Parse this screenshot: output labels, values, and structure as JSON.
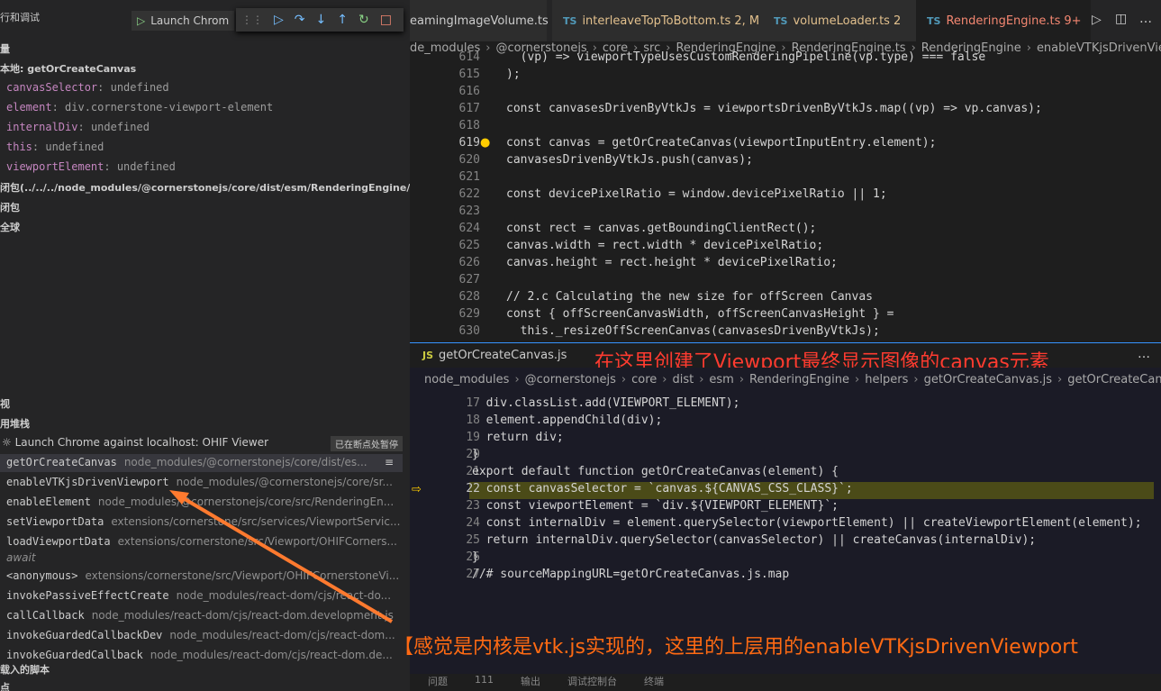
{
  "sidebar": {
    "header": "行和调试",
    "launch_label": "Launch Chrom",
    "variables_section": "量",
    "local_scope": "本地: getOrCreateCanvas",
    "variables": [
      {
        "name": "canvasSelector",
        "value": "undefined"
      },
      {
        "name": "element",
        "value": "div.cornerstone-viewport-element"
      },
      {
        "name": "internalDiv",
        "value": "undefined"
      },
      {
        "name": "this",
        "value": "undefined"
      },
      {
        "name": "viewportElement",
        "value": "undefined"
      }
    ],
    "closure_scope": "闭包(../../../node_modules/@cornerstonejs/core/dist/esm/RenderingEngine/helpers/getO",
    "closure2": "闭包",
    "global": "全球",
    "watch_section": "视",
    "callstack_section": "用堆栈",
    "session": "Launch Chrome against localhost: OHIF Viewer",
    "paused_badge": "已在断点处暂停",
    "frames": [
      {
        "fn": "getOrCreateCanvas",
        "src": "node_modules/@cornerstonejs/core/dist/es..."
      },
      {
        "fn": "enableVTKjsDrivenViewport",
        "src": "node_modules/@cornerstonejs/core/sr..."
      },
      {
        "fn": "enableElement",
        "src": "node_modules/@cornerstonejs/core/src/RenderingEn..."
      },
      {
        "fn": "setViewportData",
        "src": "extensions/cornerstone/src/services/ViewportServic..."
      },
      {
        "fn": "loadViewportData",
        "src": "extensions/cornerstone/src/Viewport/OHIFCorners..."
      },
      {
        "fn": "await",
        "src": ""
      },
      {
        "fn": "<anonymous>",
        "src": "extensions/cornerstone/src/Viewport/OHIFCornerstoneVi..."
      },
      {
        "fn": "invokePassiveEffectCreate",
        "src": "node_modules/react-dom/cjs/react-do..."
      },
      {
        "fn": "callCallback",
        "src": "node_modules/react-dom/cjs/react-dom.development.js"
      },
      {
        "fn": "invokeGuardedCallbackDev",
        "src": "node_modules/react-dom/cjs/react-dom..."
      },
      {
        "fn": "invokeGuardedCallback",
        "src": "node_modules/react-dom/cjs/react-dom.de..."
      }
    ],
    "loaded_scripts": "载入的脚本",
    "breakpoints": "点"
  },
  "tabs": [
    {
      "label": "eamingImageVolume.ts",
      "badge": ""
    },
    {
      "label": "interleaveTopToBottom.ts",
      "badge": "2, M"
    },
    {
      "label": "volumeLoader.ts",
      "badge": "2"
    },
    {
      "label": "RenderingEngine.ts",
      "badge": "9+"
    }
  ],
  "breadcrumb_top": [
    "de_modules",
    "@cornerstonejs",
    "core",
    "src",
    "RenderingEngine",
    "RenderingEngine.ts",
    "RenderingEngine",
    "enableVTKjsDrivenViewport"
  ],
  "top_lines": [
    {
      "n": "614",
      "t": "  (vp) => viewportTypeUsesCustomRenderingPipeline(vp.type) === false"
    },
    {
      "n": "615",
      "t": ");"
    },
    {
      "n": "616",
      "t": ""
    },
    {
      "n": "617",
      "t": "const canvasesDrivenByVtkJs = viewportsDrivenByVtkJs.map((vp) => vp.canvas);"
    },
    {
      "n": "618",
      "t": ""
    },
    {
      "n": "619",
      "t": "const canvas = getOrCreateCanvas(viewportInputEntry.element);"
    },
    {
      "n": "620",
      "t": "canvasesDrivenByVtkJs.push(canvas);"
    },
    {
      "n": "621",
      "t": ""
    },
    {
      "n": "622",
      "t": "const devicePixelRatio = window.devicePixelRatio || 1;"
    },
    {
      "n": "623",
      "t": ""
    },
    {
      "n": "624",
      "t": "const rect = canvas.getBoundingClientRect();"
    },
    {
      "n": "625",
      "t": "canvas.width = rect.width * devicePixelRatio;"
    },
    {
      "n": "626",
      "t": "canvas.height = rect.height * devicePixelRatio;"
    },
    {
      "n": "627",
      "t": ""
    },
    {
      "n": "628",
      "t": "// 2.c Calculating the new size for offScreen Canvas"
    },
    {
      "n": "629",
      "t": "const { offScreenCanvasWidth, offScreenCanvasHeight } ="
    },
    {
      "n": "630",
      "t": "  this._resizeOffScreenCanvas(canvasesDrivenByVtkJs);"
    }
  ],
  "peek_title": "getOrCreateCanvas.js",
  "annotation1": "在这里创建了Viewport最终显示图像的canvas元素",
  "breadcrumb_peek": [
    "node_modules",
    "@cornerstonejs",
    "core",
    "dist",
    "esm",
    "RenderingEngine",
    "helpers",
    "getOrCreateCanvas.js",
    "getOrCreateCanvas"
  ],
  "peek_lines": [
    {
      "n": "17",
      "t": "  div.classList.add(VIEWPORT_ELEMENT);"
    },
    {
      "n": "18",
      "t": "  element.appendChild(div);"
    },
    {
      "n": "19",
      "t": "  return div;"
    },
    {
      "n": "20",
      "t": "}"
    },
    {
      "n": "21",
      "t": "export default function getOrCreateCanvas(element) {"
    },
    {
      "n": "22",
      "t": "  const canvasSelector = `canvas.${CANVAS_CSS_CLASS}`;"
    },
    {
      "n": "23",
      "t": "  const viewportElement = `div.${VIEWPORT_ELEMENT}`;"
    },
    {
      "n": "24",
      "t": "  const internalDiv = element.querySelector(viewportElement) || createViewportElement(element);"
    },
    {
      "n": "25",
      "t": "  return internalDiv.querySelector(canvasSelector) || createCanvas(internalDiv);"
    },
    {
      "n": "26",
      "t": "}"
    },
    {
      "n": "27",
      "t": "//# sourceMappingURL=getOrCreateCanvas.js.map"
    }
  ],
  "annotation2": "【感觉是内核是vtk.js实现的，这里的上层用的enableVTKjsDrivenViewport",
  "panel_tabs": [
    "问题",
    "111",
    "输出",
    "调试控制台",
    "终端"
  ]
}
